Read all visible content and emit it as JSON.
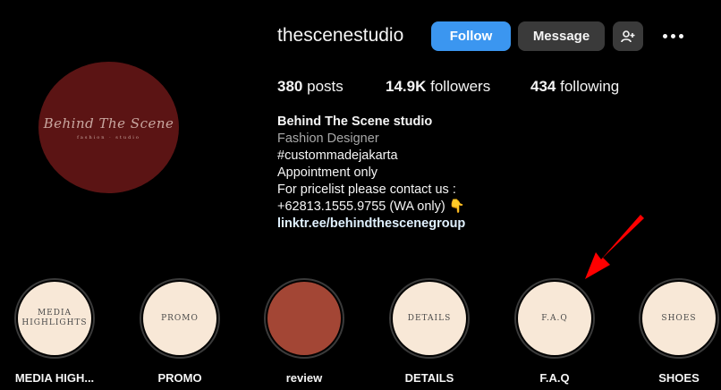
{
  "profile": {
    "username": "thescenestudio",
    "avatar_script": "Behind The Scene",
    "avatar_sub": "fashion · studio"
  },
  "header": {
    "follow_label": "Follow",
    "message_label": "Message",
    "suggest_icon": "person-add-icon",
    "more_icon": "more-dots-icon"
  },
  "stats": {
    "posts_count": "380",
    "posts_label": "posts",
    "followers_count": "14.9K",
    "followers_label": "followers",
    "following_count": "434",
    "following_label": "following"
  },
  "bio": {
    "name": "Behind The Scene studio",
    "category": "Fashion Designer",
    "lines": [
      "#custommadejakarta",
      "Appointment only",
      "For pricelist please contact us :",
      "+62813.1555.9755 (WA only) 👇"
    ],
    "link": "linktr.ee/behindthescenegroup"
  },
  "highlights": [
    {
      "cover_text_1": "MEDIA",
      "cover_text_2": "HIGHLIGHTS",
      "label": "MEDIA HIGH..."
    },
    {
      "cover_text": "PROMO",
      "label": "PROMO"
    },
    {
      "cover_text": "",
      "label": "review"
    },
    {
      "cover_text": "DETAILS",
      "label": "DETAILS"
    },
    {
      "cover_text": "F.A.Q",
      "label": "F.A.Q"
    },
    {
      "cover_text": "SHOES",
      "label": "SHOES"
    }
  ],
  "colors": {
    "background": "#000000",
    "follow_button": "#3b96f0",
    "secondary_button": "#3a3a3a",
    "avatar_bg": "#5b1414",
    "highlight_cover": "#f8e8d7",
    "review_cover": "#a34635",
    "annotation_arrow": "#ff0000"
  }
}
